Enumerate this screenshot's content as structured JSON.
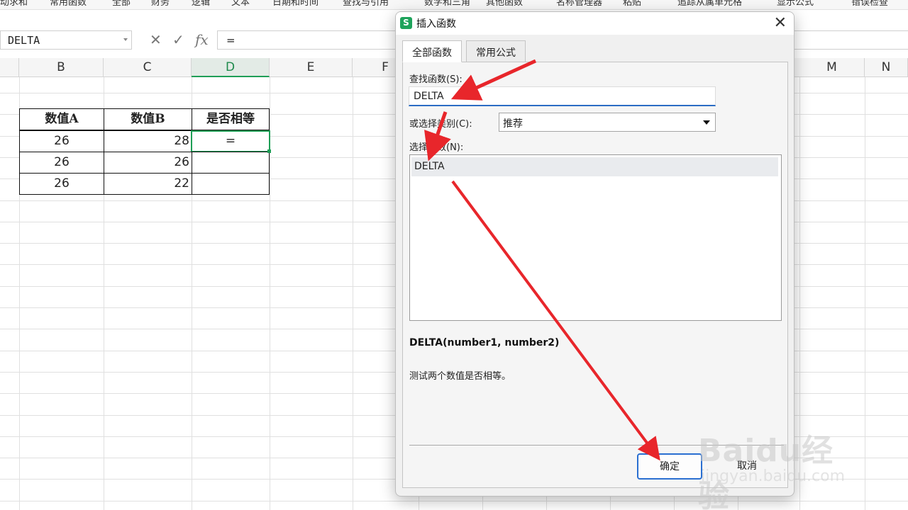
{
  "ribbon": {
    "items": [
      "动求和",
      "常用函数",
      "全部",
      "财务",
      "逻辑",
      "文本",
      "日期和时间",
      "查找与引用",
      "数学和三角",
      "其他函数",
      "名称管理器",
      "粘贴",
      "追踪从属单元格",
      "显示公式",
      "错误检查"
    ]
  },
  "formula_bar": {
    "name_box": "DELTA",
    "cancel_icon": "✕",
    "enter_icon": "✓",
    "fx_icon": "fx",
    "formula": "="
  },
  "sheet": {
    "columns": [
      "B",
      "C",
      "D",
      "E",
      "F",
      "M",
      "N"
    ],
    "active_column": "D",
    "table": {
      "headers": [
        "数值A",
        "数值B",
        "是否相等"
      ],
      "rows": [
        [
          "26",
          "28",
          "="
        ],
        [
          "26",
          "26",
          ""
        ],
        [
          "26",
          "22",
          ""
        ]
      ]
    }
  },
  "dialog": {
    "title": "插入函数",
    "logo": "S",
    "close": "✕",
    "tabs": [
      "全部函数",
      "常用公式"
    ],
    "search_label": "查找函数(S):",
    "search_value": "DELTA",
    "category_label": "或选择类别(C):",
    "category_value": "推荐",
    "select_label": "选择函数(N):",
    "functions": [
      "DELTA"
    ],
    "signature": "DELTA(number1, number2)",
    "description": "测试两个数值是否相等。",
    "ok": "确定",
    "cancel": "取消"
  },
  "watermark": {
    "brand": "Baidu经验",
    "url": "jingyan.baidu.com"
  },
  "colors": {
    "accent_green": "#1e9e56",
    "annotation_red": "#e8262b",
    "ok_border": "#2a6fd1"
  }
}
